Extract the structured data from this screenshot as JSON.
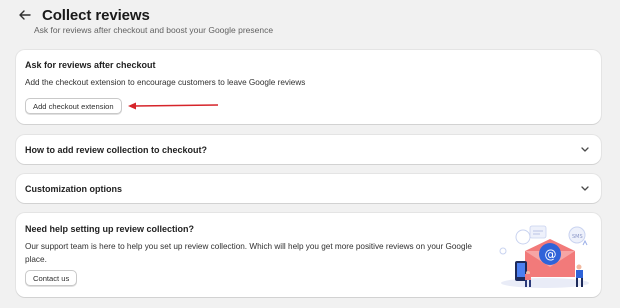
{
  "header": {
    "title": "Collect reviews",
    "subtitle": "Ask for reviews after checkout and boost your Google presence"
  },
  "checkout_card": {
    "heading": "Ask for reviews after checkout",
    "description": "Add the checkout extension to encourage customers to leave Google reviews",
    "button_label": "Add checkout extension"
  },
  "accordions": [
    {
      "label": "How to add review collection to checkout?"
    },
    {
      "label": "Customization options"
    }
  ],
  "help_card": {
    "heading": "Need help setting up review collection?",
    "description": "Our support team is here to help you set up review collection. Which will help you get more positive reviews on your Google place.",
    "button_label": "Contact us"
  },
  "icons": {
    "back": "arrow-left-icon",
    "chevron": "chevron-down-icon"
  },
  "colors": {
    "annotation_arrow": "#d6242a",
    "background": "#f1f1f1",
    "card": "#ffffff"
  }
}
